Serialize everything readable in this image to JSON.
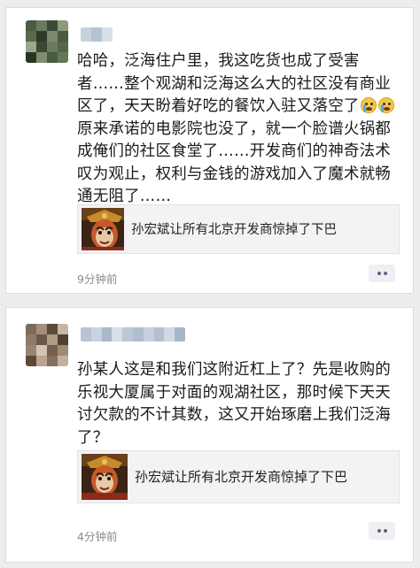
{
  "posts": [
    {
      "body_part1": "哈哈，泛海住户里，我这吃货也成了受害者……整个观湖和泛海这么大的社区没有商业区了，天天盼着好吃的餐饮入驻又落空了",
      "body_part2": "原来承诺的电影院也没了，就一个脸谱火锅都成俺们的社区食堂了……开发商们的神奇法术叹为观止，权利与金钱的游戏加入了魔术就畅通无阻了……",
      "emoji_icon": "crying-face-emoji",
      "link_title": "孙宏斌让所有北京开发商惊掉了下巴",
      "time": "9分钟前",
      "avatar_colors": [
        "#4d5a44",
        "#6b7a5f",
        "#3c4a35",
        "#8c9a7c",
        "#5a6b4d",
        "#2f3a28",
        "#7a8a6b",
        "#4a5a3f",
        "#9aa88a",
        "#3a4832",
        "#6a7a5c",
        "#556648",
        "#2a3524",
        "#7d8e6f",
        "#4b5b40",
        "#667756"
      ],
      "name_colors": [
        "#c9d2dc",
        "#b4c3d3",
        "#d8dfe6"
      ]
    },
    {
      "body": "孙某人这是和我们这附近杠上了？先是收购的乐视大厦属于对面的观湖社区，那时候下天天讨欠款的不计其数，这又开始琢磨上我们泛海了？",
      "link_title": "孙宏斌让所有北京开发商惊掉了下巴",
      "time": "4分钟前",
      "avatar_colors": [
        "#7d6b5a",
        "#a48f7a",
        "#5c4b3d",
        "#c7b6a2",
        "#8e7a66",
        "#6b5847",
        "#b09b85",
        "#4f4034",
        "#9a8572",
        "#d4c5b3",
        "#735f4e",
        "#a08a74",
        "#5a4a3c",
        "#bba58f",
        "#83705e",
        "#c2b09c"
      ],
      "name_colors": [
        "#b8c4d4",
        "#c9d3df",
        "#a9b8ca",
        "#d7dee7",
        "#bcc7d6",
        "#aebdd0",
        "#c6d0dd",
        "#b3c0d1",
        "#d0d8e3",
        "#a7b6c9"
      ]
    }
  ],
  "icons": {
    "more": "more-dots-icon",
    "thumb": "monkey-king-thumbnail"
  }
}
